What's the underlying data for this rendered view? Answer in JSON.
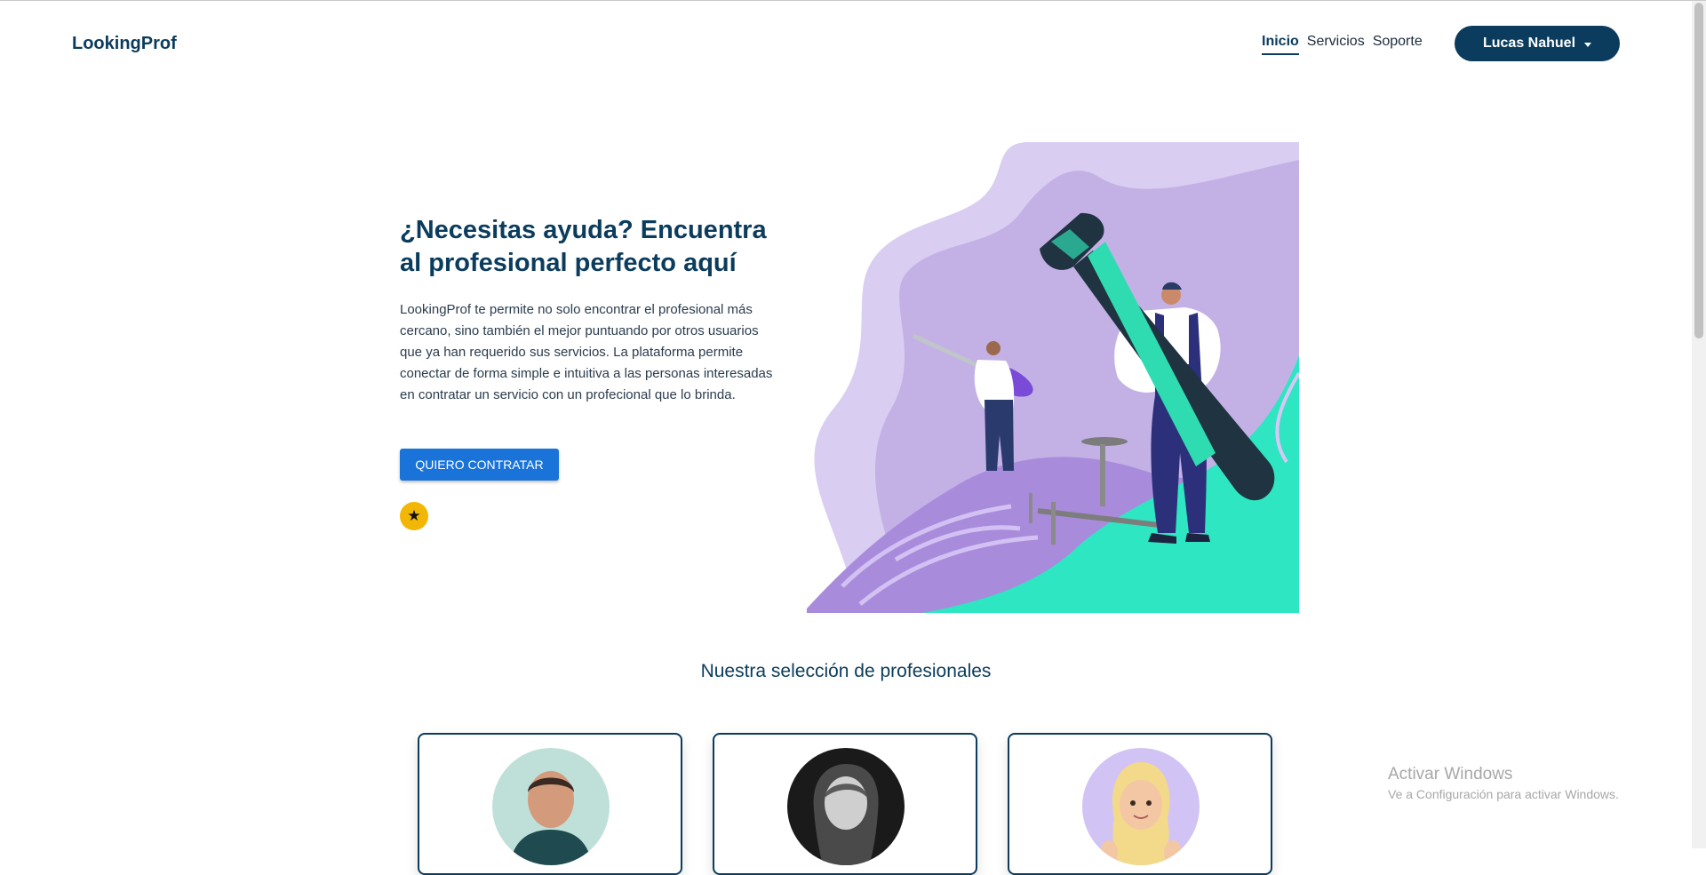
{
  "header": {
    "brand": "LookingProf",
    "nav": [
      {
        "label": "Inicio",
        "active": true
      },
      {
        "label": "Servicios",
        "active": false
      },
      {
        "label": "Soporte",
        "active": false
      }
    ],
    "user_menu_label": "Lucas Nahuel"
  },
  "hero": {
    "title": "¿Necesitas ayuda? Encuentra al profesional perfecto aquí",
    "description": "LookingProf te permite no solo encontrar el profesional más cercano, sino también el mejor puntuando por otros usuarios que ya han requerido sus servicios. La plataforma permite conectar de forma simple e intuitiva a las personas interesadas en contratar un servicio con un profecional que lo brinda.",
    "cta_label": "QUIERO CONTRATAR",
    "badge_icon": "star-icon",
    "illustration": "workers-with-hammer-and-screwdriver"
  },
  "professionals": {
    "title": "Nuestra selección de profesionales",
    "cards": [
      {
        "avatar": "man-photo"
      },
      {
        "avatar": "woman-bw-photo"
      },
      {
        "avatar": "3d-avatar-thumbs-up"
      }
    ]
  },
  "watermark": {
    "title": "Activar Windows",
    "subtitle": "Ve a Configuración para activar Windows."
  },
  "colors": {
    "primary": "#0b3c5d",
    "cta": "#1a73d9",
    "badge": "#f2b705",
    "illustration_lavender": "#c3b1e6",
    "illustration_teal": "#2ee6c2"
  }
}
